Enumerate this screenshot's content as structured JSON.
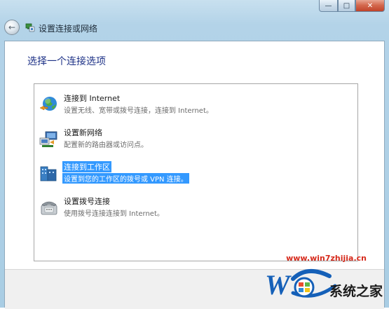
{
  "window": {
    "caption_buttons": [
      "minimize",
      "maximize",
      "close"
    ]
  },
  "header": {
    "back_icon": "back-arrow-icon",
    "icon": "network-setup-icon",
    "title": "设置连接或网络"
  },
  "content": {
    "heading": "选择一个连接选项",
    "options": [
      {
        "name": "连接到 Internet",
        "description": "设置无线、宽带或拨号连接，连接到 Internet。",
        "icon": "globe-internet-icon",
        "selected": false
      },
      {
        "name": "设置新网络",
        "description": "配置新的路由器或访问点。",
        "icon": "new-network-icon",
        "selected": false
      },
      {
        "name": "连接到工作区",
        "description": "设置到您的工作区的拨号或 VPN 连接。",
        "icon": "workplace-vpn-icon",
        "selected": true
      },
      {
        "name": "设置拨号连接",
        "description": "使用拨号连接连接到 Internet。",
        "icon": "dialup-phone-icon",
        "selected": false
      }
    ]
  },
  "watermark": {
    "url": "www.win7zhijia.cn",
    "brand_text": "系统之家",
    "logo_letter": "W"
  },
  "colors": {
    "selection": "#3399ff",
    "heading": "#1e3287",
    "watermark_red": "#d62a1c"
  }
}
